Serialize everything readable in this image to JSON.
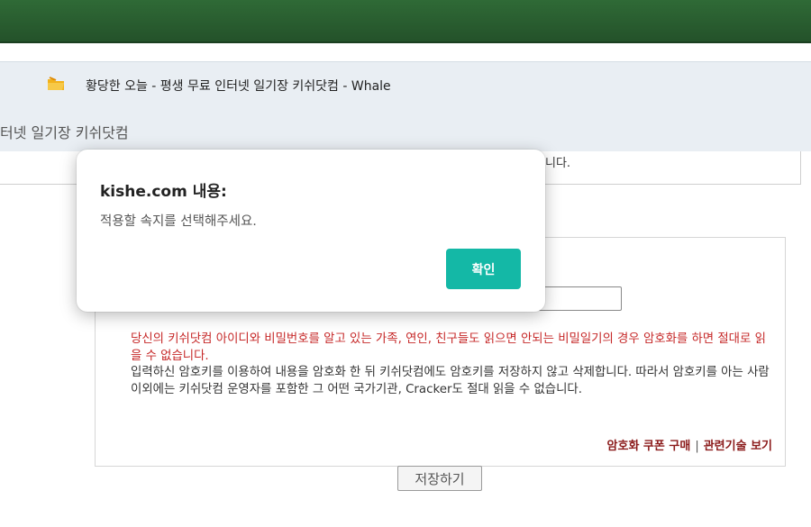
{
  "browser": {
    "window_title": "황당한 오늘 - 평생 무료 인터넷 일기장 키쉬닷컴 - Whale",
    "site_title_partial": "터넷 일기장 키쉬닷컴"
  },
  "page": {
    "partial_text": "니다."
  },
  "form": {
    "notice_warning": "당신의 키쉬닷컴 아이디와 비밀번호를 알고 있는 가족, 연인, 친구들도 읽으면 안되는 비밀일기의 경우 암호화를 하면 절대로 읽을 수 없습니다.",
    "notice_info": "입력하신 암호키를 이용하여 내용을 암호화 한 뒤 키쉬닷컴에도 암호키를 저장하지 않고 삭제합니다. 따라서 암호키를 아는 사람 이외에는 키쉬닷컴 운영자를 포함한 그 어떤 국가기관, Cracker도 절대 읽을 수 없습니다.",
    "link_buy_coupon": "암호화 쿠폰 구매",
    "link_separator": "|",
    "link_tech": "관련기술 보기",
    "save_label": "저장하기"
  },
  "dialog": {
    "title": "kishe.com 내용:",
    "message": "적용할 속지를 선택해주세요.",
    "ok_label": "확인"
  },
  "colors": {
    "topbar": "#2f6a36",
    "accent_button": "#14b8a6",
    "warning_text": "#c62828",
    "link_text": "#8b1a1a"
  }
}
